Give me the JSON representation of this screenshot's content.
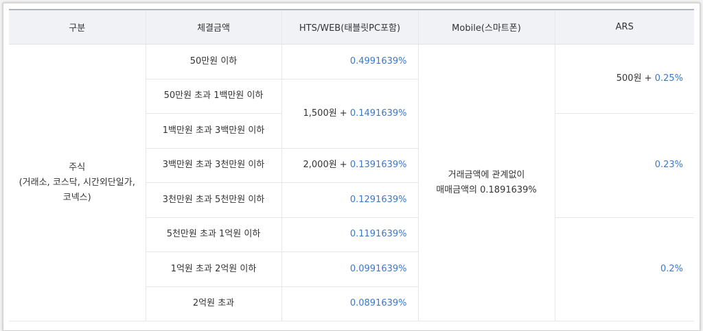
{
  "table": {
    "headers": [
      "구분",
      "체결금액",
      "HTS/WEB(태블릿PC포함)",
      "Mobile(스마트폰)",
      "ARS"
    ],
    "category": {
      "line1": "주식",
      "line2": "(거래소, 코스닥, 시간외단일가,",
      "line3": "코넥스)"
    },
    "amounts": [
      "50만원 이하",
      "50만원 초과 1백만원 이하",
      "1백만원 초과 3백만원 이하",
      "3백만원 초과 3천만원 이하",
      "3천만원 초과 5천만원 이하",
      "5천만원 초과 1억원 이하",
      "1억원 초과 2억원 이하",
      "2억원 초과"
    ],
    "hts": {
      "r1": "0.4991639%",
      "r2_prefix": "1,500원 + ",
      "r2_rate": "0.1491639%",
      "r4_prefix": "2,000원 + ",
      "r4_rate": "0.1391639%",
      "r5": "0.1291639%",
      "r6": "0.1191639%",
      "r7": "0.0991639%",
      "r8": "0.0891639%"
    },
    "mobile": {
      "line1": "거래금액에 관계없이",
      "line2": "매매금액의 0.1891639%"
    },
    "ars": {
      "a1_prefix": "500원 + ",
      "a1_rate": "0.25%",
      "a2": "0.23%",
      "a3": "0.2%"
    }
  },
  "colors": {
    "rate_blue": "#3a78c8",
    "header_bg": "#f0f2f6",
    "border": "#e6e6e6"
  }
}
